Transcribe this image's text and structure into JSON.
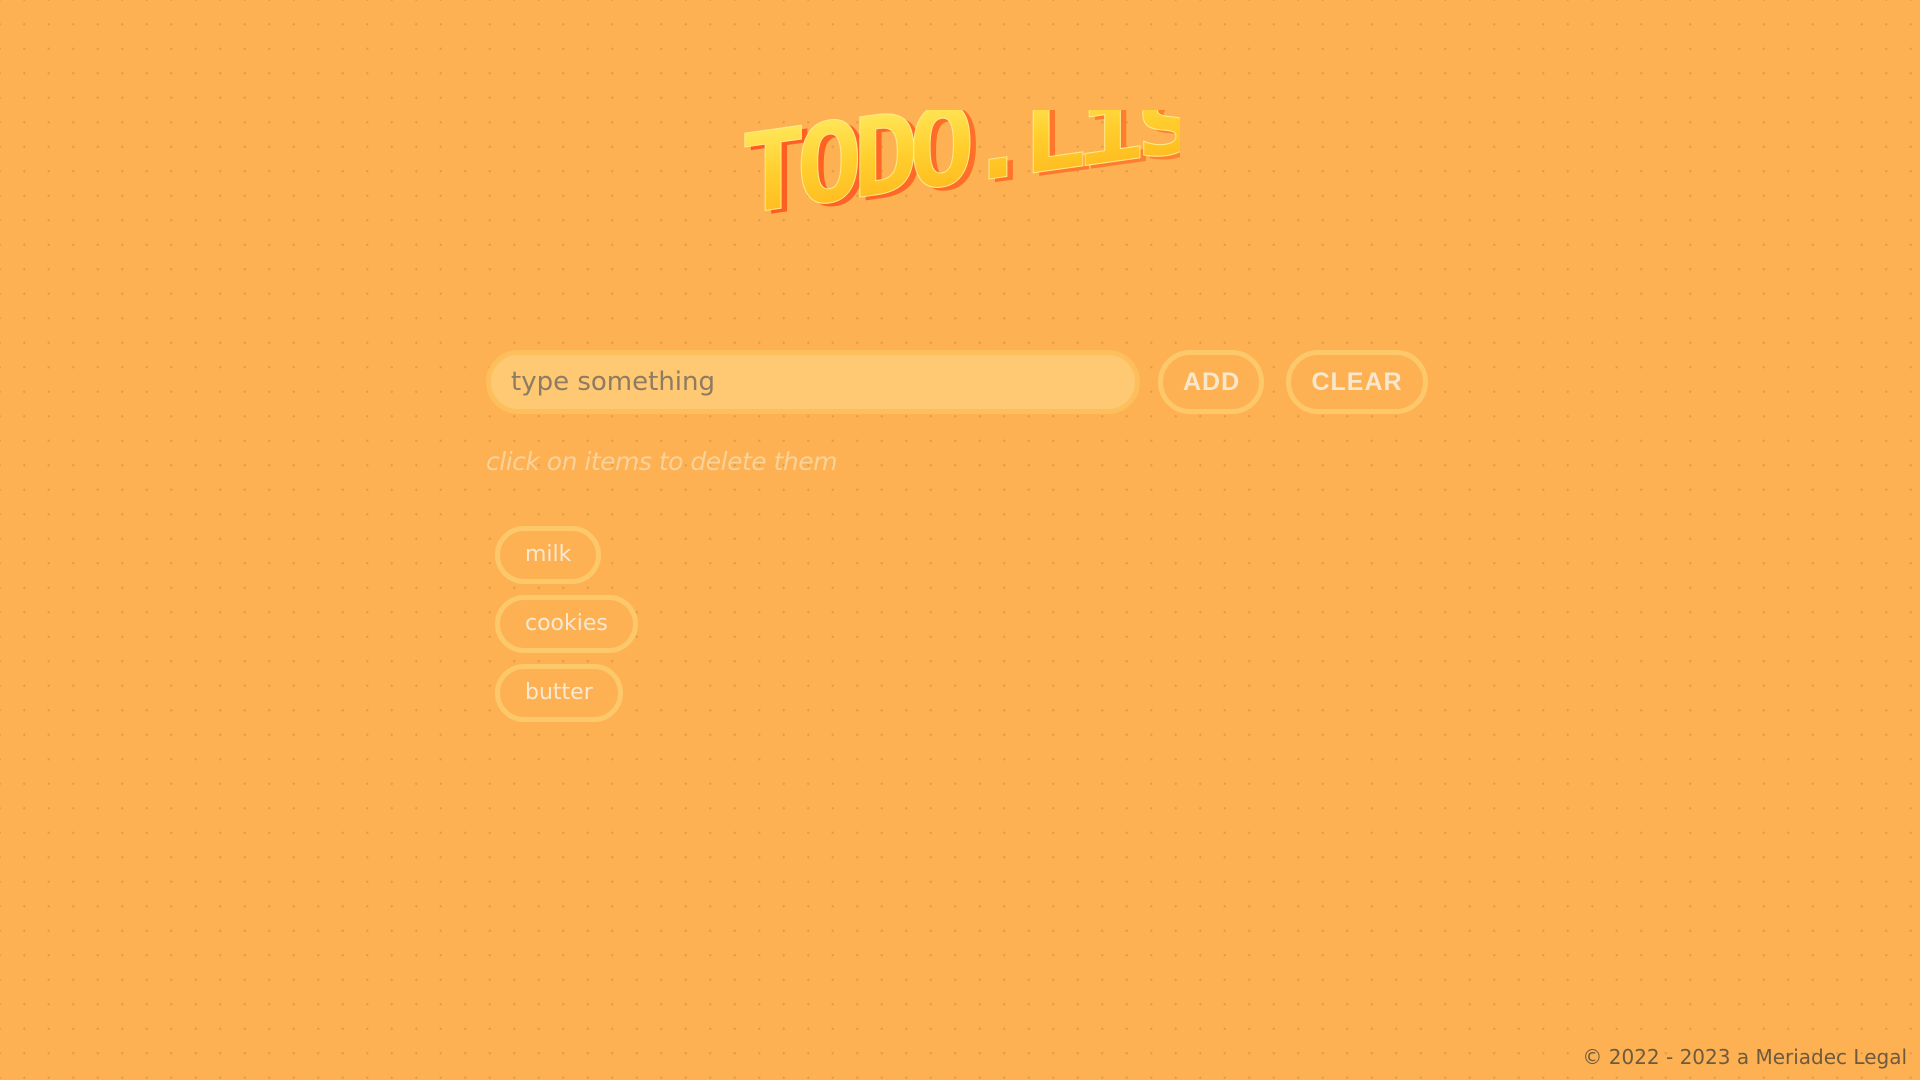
{
  "header": {
    "logo_text": "TODO.List"
  },
  "form": {
    "input_placeholder": "type something",
    "input_value": "",
    "add_label": "ADD",
    "clear_label": "CLEAR"
  },
  "hint": "click on items to delete them",
  "todos": [
    {
      "label": "milk"
    },
    {
      "label": "cookies"
    },
    {
      "label": "butter"
    }
  ],
  "footer": {
    "copyright": "© 2022 - 2023 a Meriadec Legal"
  },
  "colors": {
    "background": "#fdb153",
    "pill_border": "#fdc869",
    "input_fill": "#fec972",
    "logo_front": "#ffd13a",
    "logo_side": "#ff6a2b"
  },
  "icons": {
    "logo": "isometric-3d-title-logo"
  }
}
